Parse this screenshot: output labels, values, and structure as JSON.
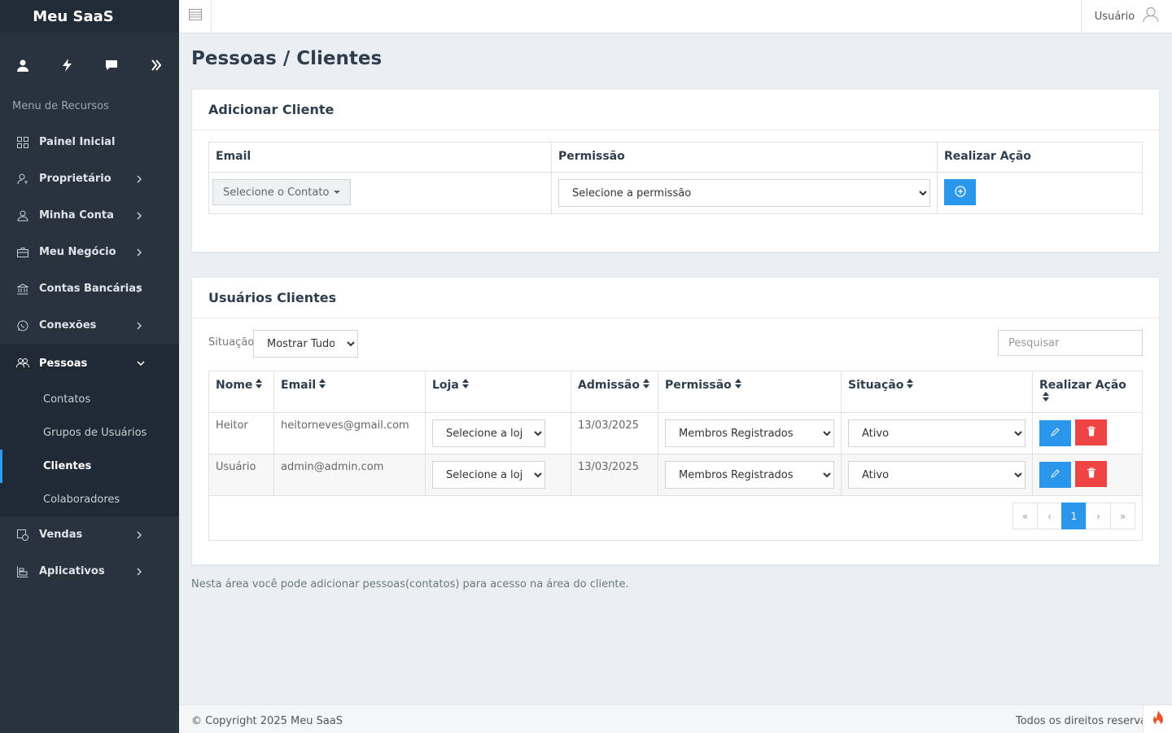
{
  "app": {
    "brand": "Meu SaaS"
  },
  "topbar": {
    "user_label": "Usuário"
  },
  "sidebar": {
    "menu_header": "Menu de Recursos",
    "items": [
      {
        "label": "Painel Inicial"
      },
      {
        "label": "Proprietário"
      },
      {
        "label": "Minha Conta"
      },
      {
        "label": "Meu Negócio"
      },
      {
        "label": "Contas Bancárias"
      },
      {
        "label": "Conexões"
      },
      {
        "label": "Pessoas"
      },
      {
        "label": "Vendas"
      },
      {
        "label": "Aplicativos"
      }
    ],
    "sub_items": [
      {
        "label": "Contatos"
      },
      {
        "label": "Grupos de Usuários"
      },
      {
        "label": "Clientes"
      },
      {
        "label": "Colaboradores"
      }
    ]
  },
  "page": {
    "title": "Pessoas / Clientes"
  },
  "add_client": {
    "title": "Adicionar Cliente",
    "col_email": "Email",
    "col_permission": "Permissão",
    "col_action": "Realizar Ação",
    "contact_select": "Selecione o Contato",
    "permission_select": "Selecione a permissão"
  },
  "client_users": {
    "title": "Usuários Clientes",
    "filter_label": "Situação",
    "filter_value": "Mostrar Tudo",
    "search_placeholder": "Pesquisar",
    "headers": [
      "Nome",
      "Email",
      "Loja",
      "Admissão",
      "Permissão",
      "Situação",
      "Realizar Ação"
    ],
    "rows": [
      {
        "name": "Heitor",
        "email": "heitorneves@gmail.com",
        "store": "Selecione a loja",
        "admission": "13/03/2025",
        "permission": "Membros Registrados",
        "status": "Ativo"
      },
      {
        "name": "Usuário",
        "email": "admin@admin.com",
        "store": "Selecione a loja",
        "admission": "13/03/2025",
        "permission": "Membros Registrados",
        "status": "Ativo"
      }
    ],
    "pagination": {
      "first": "«",
      "prev": "‹",
      "current": "1",
      "next": "›",
      "last": "»"
    }
  },
  "note": "Nesta área você pode adicionar pessoas(contatos) para acesso na área do cliente.",
  "footer": {
    "copyright": "© Copyright 2025 Meu SaaS",
    "rights": "Todos os direitos reservados"
  },
  "colors": {
    "sidebar_bg": "#28333e",
    "accent": "#2b97ec",
    "danger": "#ee4444"
  }
}
